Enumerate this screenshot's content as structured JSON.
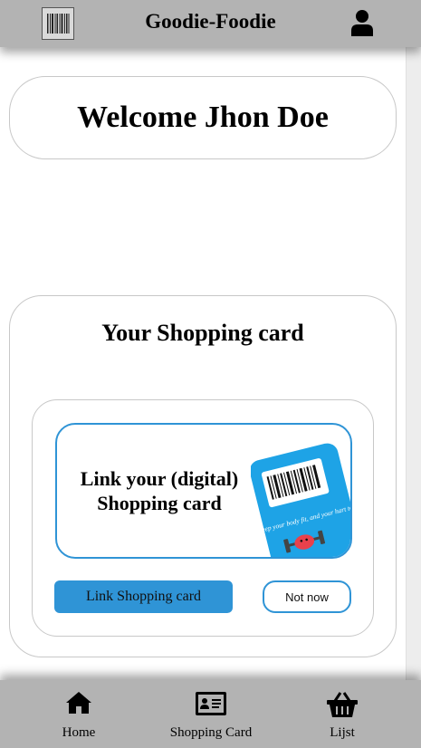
{
  "header": {
    "title": "Goodie-Foodie",
    "scan_icon": "barcode-icon",
    "profile_icon": "user-icon"
  },
  "welcome": {
    "text": "Welcome Jhon Doe"
  },
  "shopping_card": {
    "title": "Your Shopping card",
    "promo_text": "Link your (digital) Shopping card",
    "card_slogan": "Keep your body fit, and your hart too!",
    "link_button": "Link Shopping card",
    "not_now_button": "Not now"
  },
  "nav": {
    "items": [
      {
        "label": "Home",
        "icon": "home-icon"
      },
      {
        "label": "Shopping Card",
        "icon": "id-card-icon"
      },
      {
        "label": "Lijst",
        "icon": "basket-icon"
      }
    ]
  },
  "colors": {
    "bar": "#b3b3b3",
    "accent": "#2f94d6",
    "card_blue": "#1ea3e6"
  }
}
